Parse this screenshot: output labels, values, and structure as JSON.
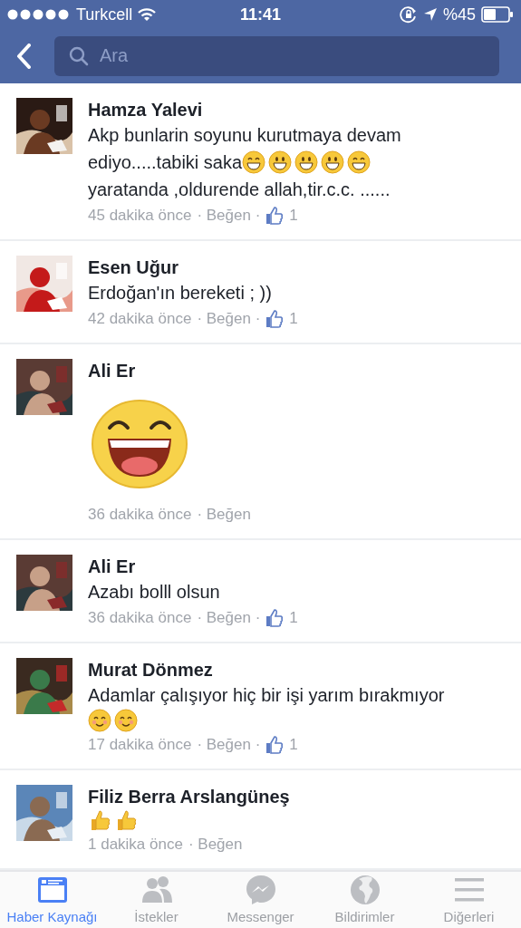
{
  "status_bar": {
    "carrier": "Turkcell",
    "time": "11:41",
    "battery": "%45"
  },
  "search": {
    "placeholder": "Ara"
  },
  "comments": [
    {
      "author": "Hamza Yalevi",
      "avatar": {
        "kind": "picture"
      },
      "lines": [
        [
          {
            "kind": "text",
            "text": "Akp bunlarin soyunu kurutmaya devam"
          }
        ],
        [
          {
            "kind": "text",
            "text": "ediyo.....tabiki saka"
          },
          {
            "kind": "grin"
          },
          {
            "kind": "smiley"
          },
          {
            "kind": "smiley"
          },
          {
            "kind": "smiley"
          },
          {
            "kind": "grin"
          }
        ],
        [
          {
            "kind": "text",
            "text": "yaratanda ,oldurende allah,tir.c.c.  ......"
          }
        ]
      ],
      "time": "45 dakika önce",
      "like": "· Beğen ·",
      "likes": "1"
    },
    {
      "author": "Esen Uğur",
      "avatar": {
        "kind": "picture"
      },
      "lines": [
        [
          {
            "kind": "text",
            "text": "Erdoğan'ın bereketi ; ))"
          }
        ]
      ],
      "time": "42 dakika önce",
      "like": "· Beğen ·",
      "likes": "1"
    },
    {
      "author": "Ali Er",
      "avatar": {
        "kind": "picture"
      },
      "lines": [
        [
          {
            "kind": "sticker"
          }
        ]
      ],
      "time": "36 dakika önce",
      "like": "· Beğen"
    },
    {
      "author": "Ali Er",
      "avatar": {
        "kind": "picture"
      },
      "lines": [
        [
          {
            "kind": "text",
            "text": "Azabı bolll olsun"
          }
        ]
      ],
      "time": "36 dakika önce",
      "like": "· Beğen ·",
      "likes": "1"
    },
    {
      "author": "Murat Dönmez",
      "avatar": {
        "kind": "picture"
      },
      "lines": [
        [
          {
            "kind": "text",
            "text": "Adamlar çalışıyor hiç bir işi yarım bırakmıyor"
          }
        ],
        [
          {
            "kind": "blush"
          },
          {
            "kind": "blush"
          }
        ]
      ],
      "time": "17 dakika önce",
      "like": "· Beğen ·",
      "likes": "1"
    },
    {
      "author": "Filiz Berra Arslangüneş",
      "avatar": {
        "kind": "picture"
      },
      "lines": [
        [
          {
            "kind": "thumbs"
          },
          {
            "kind": "thumbs"
          }
        ]
      ],
      "time": "1 dakika önce",
      "like": "· Beğen"
    }
  ],
  "tabs": [
    {
      "label": "Haber Kaynağı",
      "selected": true
    },
    {
      "label": "İstekler",
      "selected": false
    },
    {
      "label": "Messenger",
      "selected": false
    },
    {
      "label": "Bildirimler",
      "selected": false
    },
    {
      "label": "Diğerleri",
      "selected": false
    }
  ]
}
